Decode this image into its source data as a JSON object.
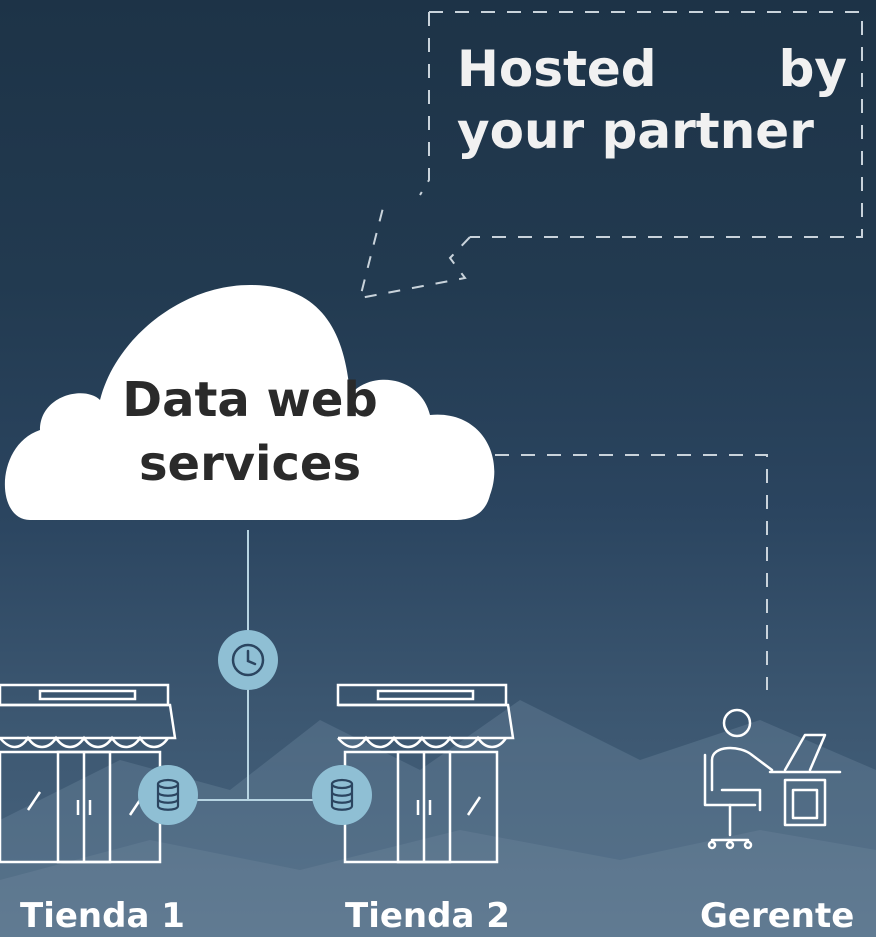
{
  "callout": {
    "text": "Hosted by your partner"
  },
  "cloud": {
    "label": "Data web services"
  },
  "nodes": {
    "store1": {
      "label": "Tienda 1"
    },
    "store2": {
      "label": "Tienda 2"
    },
    "manager": {
      "label": "Gerente"
    }
  },
  "icons": {
    "cloud": "cloud-icon",
    "clock": "clock-icon",
    "database": "database-icon",
    "store": "storefront-icon",
    "manager": "person-at-desk-icon"
  },
  "colors": {
    "background_top": "#1d3347",
    "background_bottom": "#4a6680",
    "icon_stroke": "#ffffff",
    "badge_fill": "#8fbfd4",
    "cloud_fill": "#ffffff",
    "cloud_text": "#2a2a2a"
  }
}
